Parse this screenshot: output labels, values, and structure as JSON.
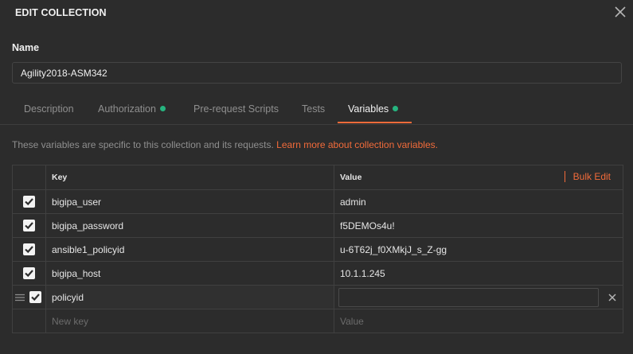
{
  "header": {
    "title": "EDIT COLLECTION"
  },
  "name_field": {
    "label": "Name",
    "value": "Agility2018-ASM342"
  },
  "tabs": [
    {
      "label": "Description",
      "dot": false,
      "active": false
    },
    {
      "label": "Authorization",
      "dot": true,
      "active": false
    },
    {
      "label": "Pre-request Scripts",
      "dot": false,
      "active": false
    },
    {
      "label": "Tests",
      "dot": false,
      "active": false
    },
    {
      "label": "Variables",
      "dot": true,
      "active": true
    }
  ],
  "info": {
    "text": "These variables are specific to this collection and its requests. ",
    "link": "Learn more about collection variables."
  },
  "variables_table": {
    "columns": {
      "key": "Key",
      "value": "Value"
    },
    "bulk_edit": "Bulk Edit",
    "rows": [
      {
        "checked": true,
        "key": "bigipa_user",
        "value": "admin"
      },
      {
        "checked": true,
        "key": "bigipa_password",
        "value": "f5DEMOs4u!"
      },
      {
        "checked": true,
        "key": "ansible1_policyid",
        "value": "u-6T62j_f0XMkjJ_s_Z-gg"
      },
      {
        "checked": true,
        "key": "bigipa_host",
        "value": "10.1.1.245"
      }
    ],
    "editing_row": {
      "checked": true,
      "key": "policyid",
      "value": ""
    },
    "new_row": {
      "key_placeholder": "New key",
      "value_placeholder": "Value"
    }
  },
  "colors": {
    "accent": "#f26b3a",
    "status_dot": "#26b47f",
    "background": "#2c2c2c"
  }
}
